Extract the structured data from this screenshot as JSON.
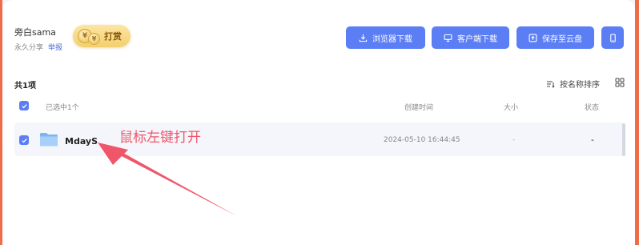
{
  "header": {
    "owner": "旁白sama",
    "share_duration": "永久分享",
    "report_label": "举报",
    "tip_label": "打赏",
    "coin_symbol": "¥"
  },
  "actions": {
    "browser_download": "浏览器下载",
    "client_download": "客户端下载",
    "save_to_cloud": "保存至云盘",
    "phone_icon": "phone-icon"
  },
  "list": {
    "count": "共1项",
    "sort_label": "按名称排序",
    "selected_label": "已选中1个",
    "columns": {
      "time": "创建时间",
      "size": "大小",
      "status": "状态"
    },
    "items": [
      {
        "name": "MdayS",
        "created": "2024-05-10 16:44:45",
        "size": "-",
        "status": "-",
        "checked": true
      }
    ]
  },
  "annotation": "鼠标左键打开",
  "colors": {
    "accent": "#5b7ef5",
    "frame": "#f06b48",
    "annotation": "#f0566a"
  }
}
